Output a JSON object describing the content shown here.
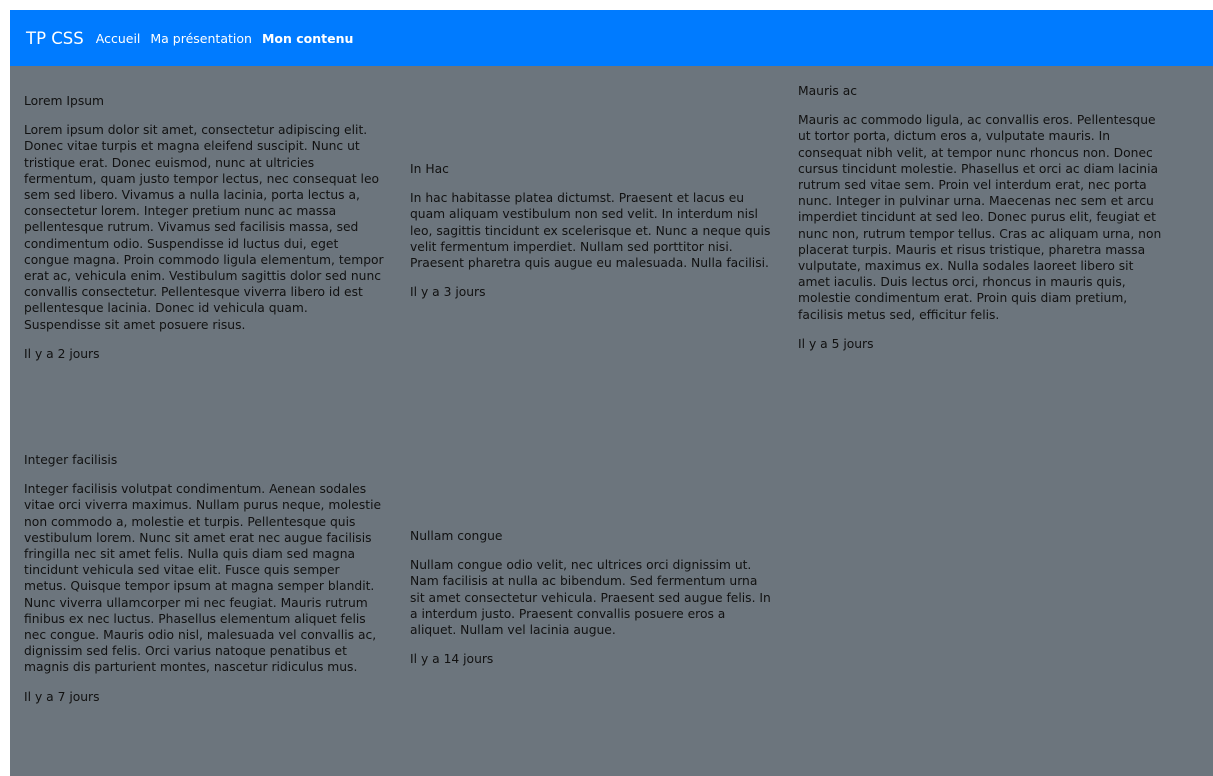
{
  "navbar": {
    "brand": "TP CSS",
    "links": [
      {
        "label": "Accueil",
        "active": false
      },
      {
        "label": "Ma présentation",
        "active": false
      },
      {
        "label": "Mon contenu",
        "active": true
      }
    ]
  },
  "cards": [
    {
      "title": "Lorem Ipsum",
      "text": "Lorem ipsum dolor sit amet, consectetur adipiscing elit. Donec vitae turpis et magna eleifend suscipit. Nunc ut tristique erat. Donec euismod, nunc at ultricies fermentum, quam justo tempor lectus, nec consequat leo sem sed libero. Vivamus a nulla lacinia, porta lectus a, consectetur lorem. Integer pretium nunc ac massa pellentesque rutrum. Vivamus sed facilisis massa, sed condimentum odio. Suspendisse id luctus dui, eget congue magna. Proin commodo ligula elementum, tempor erat ac, vehicula enim. Vestibulum sagittis dolor sed nunc convallis consectetur. Pellentesque viverra libero id est pellentesque lacinia. Donec id vehicula quam. Suspendisse sit amet posuere risus.",
      "date": "Il y a 2 jours"
    },
    {
      "title": "In Hac",
      "text": "In hac habitasse platea dictumst. Praesent et lacus eu quam aliquam vestibulum non sed velit. In interdum nisl leo, sagittis tincidunt ex scelerisque et. Nunc a neque quis velit fermentum imperdiet. Nullam sed porttitor nisi. Praesent pharetra quis augue eu malesuada. Nulla facilisi.",
      "date": "Il y a 3 jours"
    },
    {
      "title": "Mauris ac",
      "text": "Mauris ac commodo ligula, ac convallis eros. Pellentesque ut tortor porta, dictum eros a, vulputate mauris. In consequat nibh velit, at tempor nunc rhoncus non. Donec cursus tincidunt molestie. Phasellus et orci ac diam lacinia rutrum sed vitae sem. Proin vel interdum erat, nec porta nunc. Integer in pulvinar urna. Maecenas nec sem et arcu imperdiet tincidunt at sed leo. Donec purus elit, feugiat et nunc non, rutrum tempor tellus. Cras ac aliquam urna, non placerat turpis. Mauris et risus tristique, pharetra massa vulputate, maximus ex. Nulla sodales laoreet libero sit amet iaculis. Duis lectus orci, rhoncus in mauris quis, molestie condimentum erat. Proin quis diam pretium, facilisis metus sed, efficitur felis.",
      "date": "Il y a 5 jours"
    },
    {
      "title": "Integer facilisis",
      "text": "Integer facilisis volutpat condimentum. Aenean sodales vitae orci viverra maximus. Nullam purus neque, molestie non commodo a, molestie et turpis. Pellentesque quis vestibulum lorem. Nunc sit amet erat nec augue facilisis fringilla nec sit amet felis. Nulla quis diam sed magna tincidunt vehicula sed vitae elit. Fusce quis semper metus. Quisque tempor ipsum at magna semper blandit. Nunc viverra ullamcorper mi nec feugiat. Mauris rutrum finibus ex nec luctus. Phasellus elementum aliquet felis nec congue. Mauris odio nisl, malesuada vel convallis ac, dignissim sed felis. Orci varius natoque penatibus et magnis dis parturient montes, nascetur ridiculus mus.",
      "date": "Il y a 7 jours"
    },
    {
      "title": "Nullam congue",
      "text": "Nullam congue odio velit, nec ultrices orci dignissim ut. Nam facilisis at nulla ac bibendum. Sed fermentum urna sit amet consectetur vehicula. Praesent sed augue felis. In a interdum justo. Praesent convallis posuere eros a aliquet. Nullam vel lacinia augue.",
      "date": "Il y a 14 jours"
    }
  ],
  "colors": {
    "navbar": "#007bff",
    "background": "#6c757d",
    "text": "#111111",
    "nav_text": "#ffffff"
  }
}
